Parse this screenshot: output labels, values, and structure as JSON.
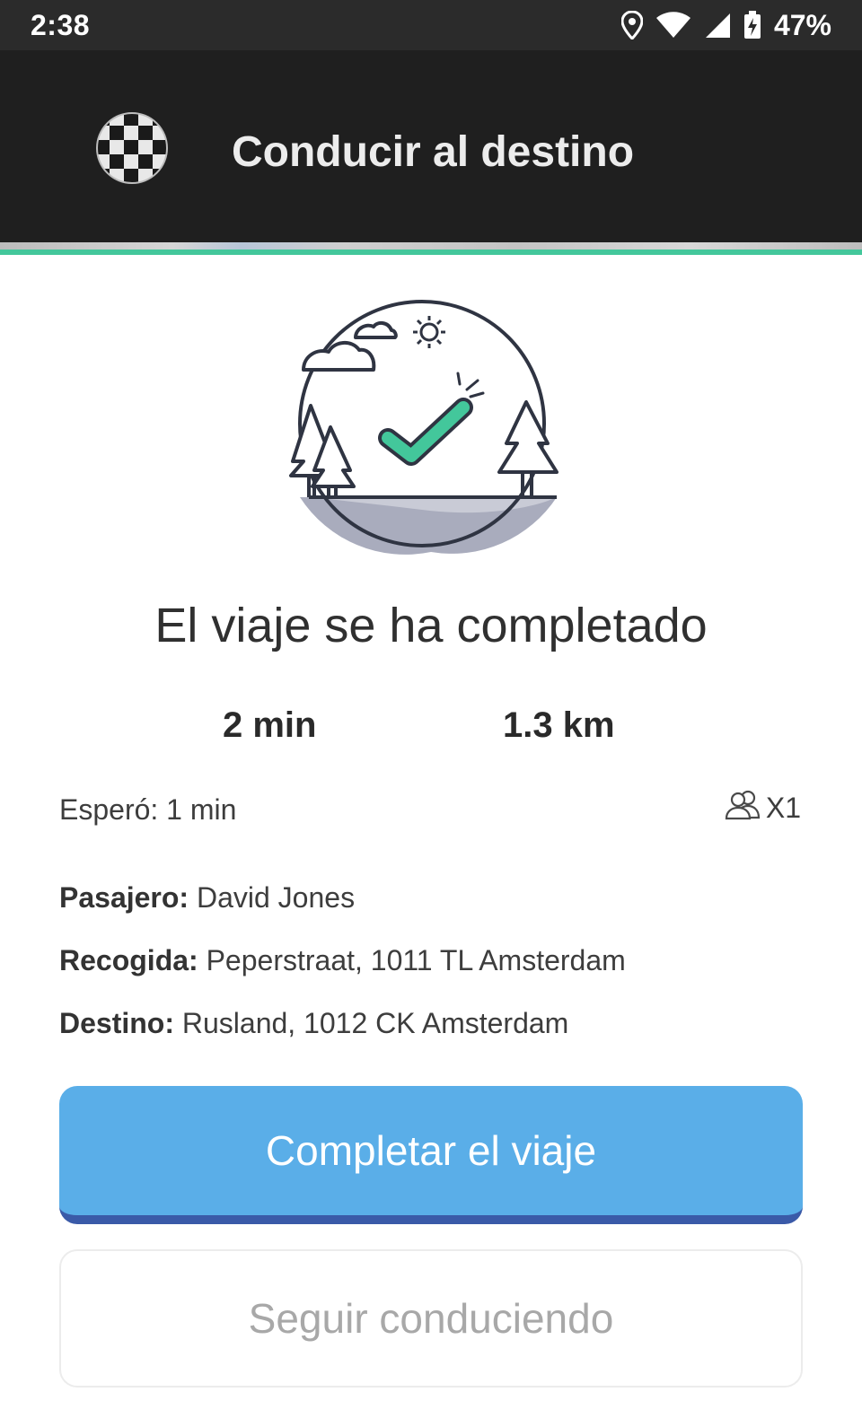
{
  "status_bar": {
    "time": "2:38",
    "battery": "47%",
    "icons": [
      "location-icon",
      "wifi-icon",
      "signal-icon",
      "battery-charging-icon"
    ]
  },
  "app_bar": {
    "title": "Conducir al destino",
    "icon": "checkered-flag-icon"
  },
  "trip": {
    "title": "El viaje se ha completado",
    "duration": "2 min",
    "distance": "1.3 km",
    "waited": "Esperó: 1 min",
    "passengers_icon": "passengers-icon",
    "passengers_count": "X1"
  },
  "details": {
    "passenger_label": "Pasajero:",
    "passenger_value": "David Jones",
    "pickup_label": "Recogida:",
    "pickup_value": "Peperstraat, 1011 TL Amsterdam",
    "destination_label": "Destino:",
    "destination_value": "Rusland, 1012 CK Amsterdam"
  },
  "actions": {
    "complete_label": "Completar el viaje",
    "continue_label": "Seguir conduciendo"
  },
  "colors": {
    "app_bar": "#1f1f1f",
    "accent_green": "#43c79b",
    "primary_button": "#5aaee8",
    "primary_button_shadow": "#3a5aa8"
  }
}
